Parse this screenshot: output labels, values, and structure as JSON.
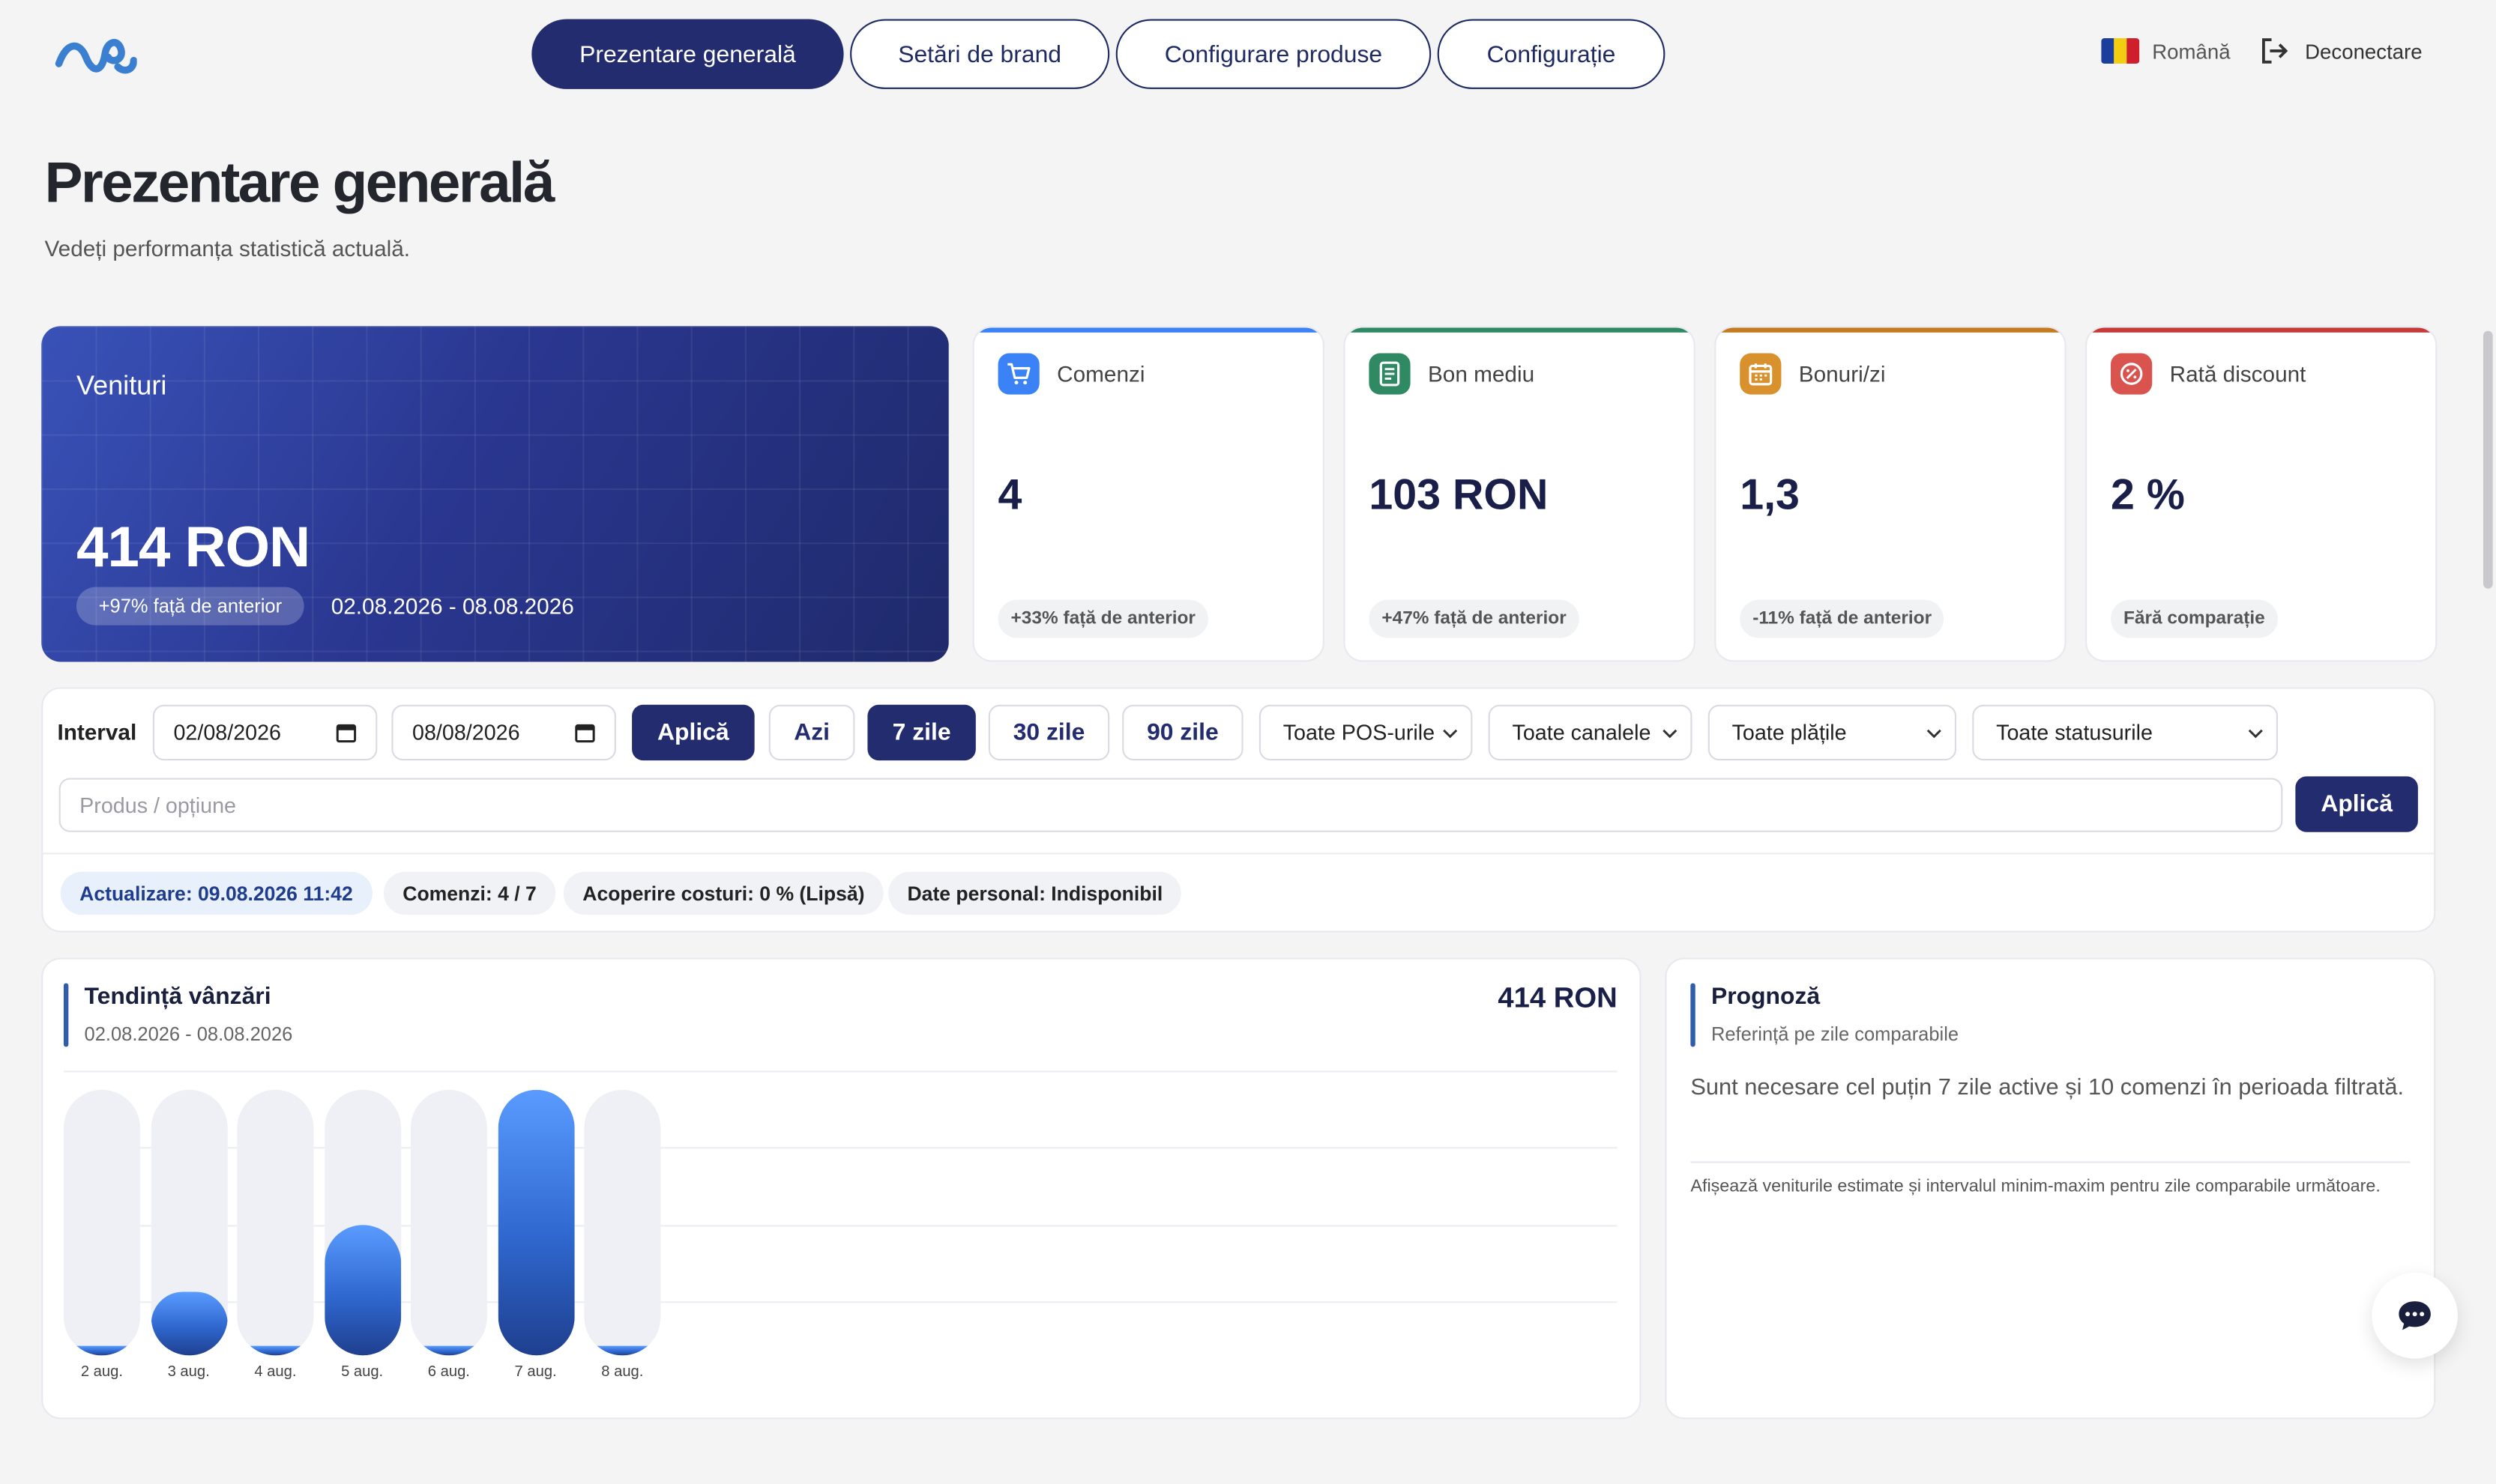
{
  "nav": {
    "tabs": [
      {
        "label": "Prezentare generală",
        "active": true
      },
      {
        "label": "Setări de brand",
        "active": false
      },
      {
        "label": "Configurare produse",
        "active": false
      },
      {
        "label": "Configurație",
        "active": false
      }
    ],
    "language": "Română",
    "logout": "Deconectare"
  },
  "page": {
    "title": "Prezentare generală",
    "subtitle": "Vedeți performanța statistică actuală."
  },
  "revenue": {
    "title": "Venituri",
    "value": "414 RON",
    "change": "+97% față de anterior",
    "range": "02.08.2026 - 08.08.2026"
  },
  "kpis": [
    {
      "label": "Comenzi",
      "value": "4",
      "change": "+33% față de anterior",
      "color": "#3b82f6",
      "icon": "cart-icon"
    },
    {
      "label": "Bon mediu",
      "value": "103 RON",
      "change": "+47% față de anterior",
      "color": "#2f8a63",
      "icon": "receipt-icon"
    },
    {
      "label": "Bonuri/zi",
      "value": "1,3",
      "change": "-11% față de anterior",
      "color": "#c47a1e",
      "icon": "calendar-icon"
    },
    {
      "label": "Rată discount",
      "value": "2 %",
      "change": "Fără comparație",
      "color": "#c63a3a",
      "icon": "discount-icon"
    }
  ],
  "filters": {
    "label": "Interval",
    "date_from": "02/08/2026",
    "date_to": "08/08/2026",
    "apply": "Aplică",
    "presets": [
      {
        "label": "Azi",
        "active": false
      },
      {
        "label": "7 zile",
        "active": true
      },
      {
        "label": "30 zile",
        "active": false
      },
      {
        "label": "90 zile",
        "active": false
      }
    ],
    "selects": [
      "Toate POS-urile",
      "Toate canalele",
      "Toate plățile",
      "Toate statusurile"
    ],
    "search_placeholder": "Produs / opțiune",
    "search_apply": "Aplică"
  },
  "status": [
    "Actualizare: 09.08.2026 11:42",
    "Comenzi: 4 / 7",
    "Acoperire costuri: 0 % (Lipsă)",
    "Date personal: Indisponibil"
  ],
  "trend": {
    "title": "Tendință vânzări",
    "range": "02.08.2026 - 08.08.2026",
    "total": "414 RON"
  },
  "chart_data": {
    "type": "bar",
    "categories": [
      "2 aug.",
      "3 aug.",
      "4 aug.",
      "5 aug.",
      "6 aug.",
      "7 aug.",
      "8 aug."
    ],
    "values": [
      0,
      40,
      0,
      81,
      0,
      165,
      0
    ],
    "ylim": [
      0,
      165
    ],
    "grid": true
  },
  "forecast": {
    "title": "Prognoză",
    "subtitle": "Referință pe zile comparabile",
    "message": "Sunt necesare cel puțin 7 zile active și 10 comenzi în perioada filtrată.",
    "note": "Afișează veniturile estimate și intervalul minim-maxim pentru zile comparabile următoare."
  }
}
